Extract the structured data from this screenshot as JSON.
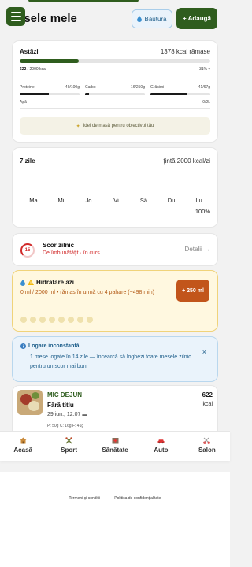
{
  "header": {
    "title": "esele mele",
    "drink_button": "Băutură",
    "add_button": "+ Adaugă"
  },
  "today": {
    "title": "Astăzi",
    "remaining": "1378 kcal rămase",
    "kcal_consumed": "622",
    "kcal_goal": "/ 2000 kcal",
    "kcal_fraction": 0.31,
    "kcal_percent": "31%",
    "macros": [
      {
        "label": "Proteine",
        "value": "49/100g",
        "fraction": 0.49
      },
      {
        "label": "Carbo",
        "value": "16/250g",
        "fraction": 0.064
      },
      {
        "label": "Grăsimi",
        "value": "41/67g",
        "fraction": 0.61
      }
    ],
    "water_label": "Apă",
    "water_value": "0/2L",
    "water_fraction": 0,
    "idea_button": "Idei de masă pentru obiectivul tău"
  },
  "week": {
    "title": "7 zile",
    "target": "țintă 2000 kcal/zi",
    "days": [
      "Ma",
      "Mi",
      "Jo",
      "Vi",
      "Sâ",
      "Du",
      "Lu"
    ],
    "last_percent": "100%"
  },
  "score": {
    "badge": "15",
    "title": "Scor zilnic",
    "subtitle": "De îmbunătățit · în curs",
    "link": "Detalii →"
  },
  "hydration": {
    "title": "Hidratare azi",
    "text": "0 ml / 2000 ml • rămas în urmă cu 4 pahare (~498 min)",
    "button": "+ 250 ml",
    "glasses_total": 8,
    "glasses_filled": 0
  },
  "alert": {
    "title": "Logare inconstantă",
    "text": "1 mese logate în 14 zile — încearcă să loghezi toate mesele zilnic pentru un scor mai bun.",
    "close": "×"
  },
  "meal": {
    "type": "MIC DEJUN",
    "name": "Fără titlu",
    "time": "29 iun., 12:07",
    "macros": "P: 50g   C: 16g   F: 41g",
    "kcal": "622",
    "kcal_unit": "kcal"
  },
  "nav": [
    {
      "label": "Acasă",
      "icon": "home-icon"
    },
    {
      "label": "Sport",
      "icon": "dumbbell-icon"
    },
    {
      "label": "Sănătate",
      "icon": "hospital-icon"
    },
    {
      "label": "Auto",
      "icon": "car-icon"
    },
    {
      "label": "Salon",
      "icon": "scissors-icon"
    }
  ],
  "footer": {
    "terms": "Termeni și condiții",
    "privacy": "Politica de confidențialitate"
  },
  "colors": {
    "primary": "#2f5d1e",
    "danger": "#d12b2b",
    "warning_bg": "#fff8e0",
    "info_bg": "#eaf3fb",
    "accent_orange": "#c2551b"
  }
}
